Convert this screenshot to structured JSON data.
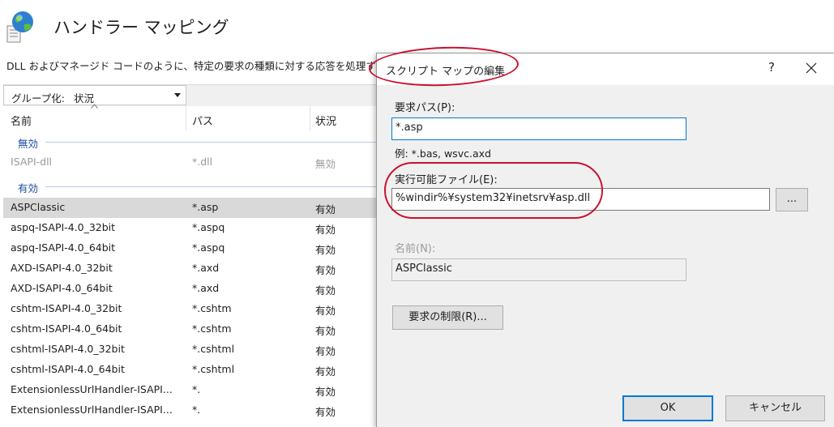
{
  "page": {
    "title": "ハンドラー マッピング",
    "description": "DLL およびマネージド コードのように、特定の要求の種類に対する応答を処理す"
  },
  "toolbar": {
    "group_label": "グループ化:",
    "group_value": "状況"
  },
  "columns": [
    "名前",
    "パス",
    "状況"
  ],
  "groups": {
    "disabled": "無効",
    "enabled": "有効"
  },
  "disabled_rows": [
    {
      "name": "ISAPI-dll",
      "path": "*.dll",
      "status": "無効"
    }
  ],
  "rows": [
    {
      "name": "ASPClassic",
      "path": "*.asp",
      "status": "有効",
      "selected": true
    },
    {
      "name": "aspq-ISAPI-4.0_32bit",
      "path": "*.aspq",
      "status": "有効"
    },
    {
      "name": "aspq-ISAPI-4.0_64bit",
      "path": "*.aspq",
      "status": "有効"
    },
    {
      "name": "AXD-ISAPI-4.0_32bit",
      "path": "*.axd",
      "status": "有効"
    },
    {
      "name": "AXD-ISAPI-4.0_64bit",
      "path": "*.axd",
      "status": "有効"
    },
    {
      "name": "cshtm-ISAPI-4.0_32bit",
      "path": "*.cshtm",
      "status": "有効"
    },
    {
      "name": "cshtm-ISAPI-4.0_64bit",
      "path": "*.cshtm",
      "status": "有効"
    },
    {
      "name": "cshtml-ISAPI-4.0_32bit",
      "path": "*.cshtml",
      "status": "有効"
    },
    {
      "name": "cshtml-ISAPI-4.0_64bit",
      "path": "*.cshtml",
      "status": "有効"
    },
    {
      "name": "ExtensionlessUrlHandler-ISAPI...",
      "path": "*.",
      "status": "有効"
    },
    {
      "name": "ExtensionlessUrlHandler-ISAPI...",
      "path": "*.",
      "status": "有効"
    }
  ],
  "dialog": {
    "title": "スクリプト マップの編集",
    "help": "?",
    "request_path_label": "要求パス(P):",
    "request_path_value": "*.asp",
    "example": "例: *.bas, wsvc.axd",
    "executable_label": "実行可能ファイル(E):",
    "executable_value": "%windir%¥system32¥inetsrv¥asp.dll",
    "browse_label": "...",
    "name_label": "名前(N):",
    "name_value": "ASPClassic",
    "restrictions_label": "要求の制限(R)...",
    "ok_label": "OK",
    "cancel_label": "キャンセル"
  },
  "colors": {
    "annotation": "#c8102e",
    "focus": "#0078d7",
    "selected_row": "#d9d9d9",
    "group_header": "#1e4fa0"
  },
  "icons": [
    "handler-mappings-icon",
    "sort-caret-icon",
    "dropdown-arrow-icon",
    "close-icon"
  ]
}
